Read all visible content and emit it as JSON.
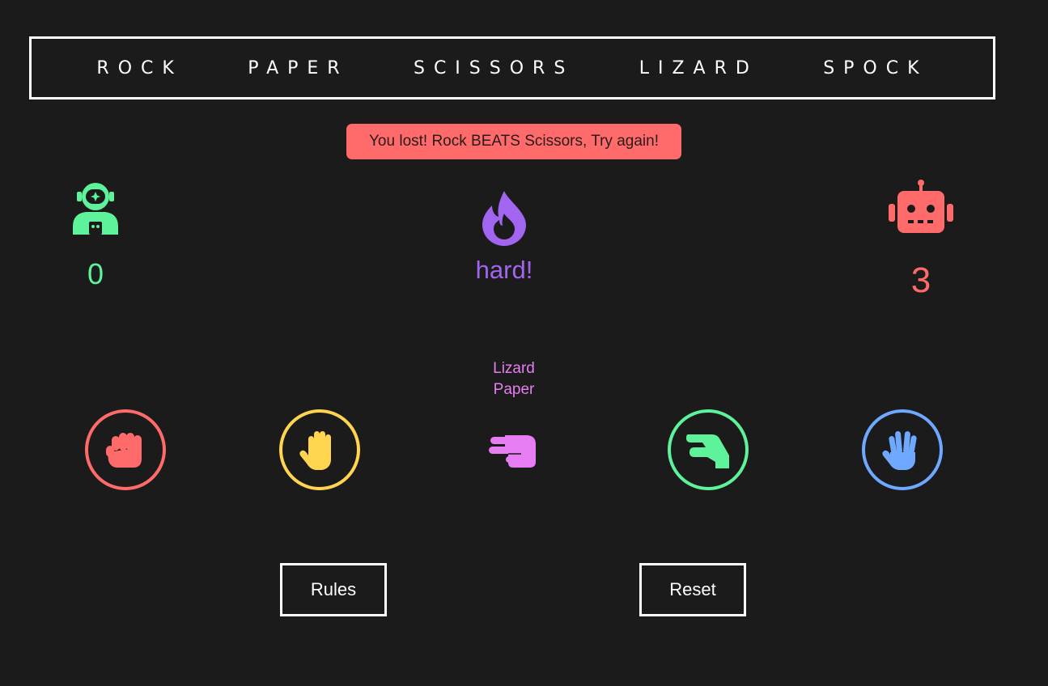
{
  "title_words": [
    "ROCK",
    "PAPER",
    "SCISSORS",
    "LIZARD",
    "SPOCK"
  ],
  "message": "You lost! Rock BEATS Scissors, Try again!",
  "player": {
    "icon": "astronaut-icon",
    "score": "0"
  },
  "difficulty": {
    "icon": "fire-icon",
    "label": "hard!"
  },
  "computer": {
    "icon": "robot-icon",
    "score": "3"
  },
  "hint": {
    "line1": "Lizard",
    "line2": "Paper"
  },
  "choices": [
    {
      "name": "rock",
      "icon": "hand-rock-icon",
      "color": "#ff6b6b"
    },
    {
      "name": "paper",
      "icon": "hand-paper-icon",
      "color": "#ffd54f"
    },
    {
      "name": "scissors",
      "icon": "hand-scissors-icon",
      "color": "#e77df2"
    },
    {
      "name": "lizard",
      "icon": "hand-lizard-icon",
      "color": "#5ef29b"
    },
    {
      "name": "spock",
      "icon": "hand-spock-icon",
      "color": "#6ea8ff"
    }
  ],
  "buttons": {
    "rules": "Rules",
    "reset": "Reset"
  },
  "colors": {
    "background": "#1b1b1b",
    "player": "#5ef29b",
    "difficulty": "#a165ef",
    "computer": "#ff6b6b",
    "hint": "#e77df2",
    "message_bg": "#ff6b6b"
  }
}
